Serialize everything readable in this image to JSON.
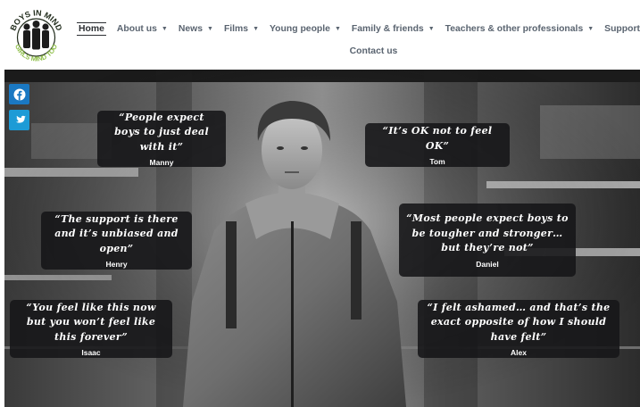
{
  "logo": {
    "top_text": "BOYS IN MIND",
    "bottom_text": "GIRLS MIND TOO"
  },
  "nav": {
    "items": [
      {
        "label": "Home",
        "active": true,
        "dropdown": false
      },
      {
        "label": "About us",
        "dropdown": true
      },
      {
        "label": "News",
        "dropdown": true
      },
      {
        "label": "Films",
        "dropdown": true
      },
      {
        "label": "Young people",
        "dropdown": true
      },
      {
        "label": "Family & friends",
        "dropdown": true
      },
      {
        "label": "Teachers & other professionals",
        "dropdown": true
      },
      {
        "label": "Support us",
        "dropdown": true
      }
    ],
    "second_row": [
      {
        "label": "Contact us",
        "dropdown": false
      }
    ],
    "caret": "▼"
  },
  "social": [
    {
      "name": "facebook-icon",
      "color": "#1a78c2"
    },
    {
      "name": "twitter-icon",
      "color": "#1d9bd6"
    }
  ],
  "quotes": [
    {
      "text": "“People expect boys to just deal with it”",
      "name": "Manny"
    },
    {
      "text": "“It’s OK not to feel OK”",
      "name": "Tom"
    },
    {
      "text": "“The support is there and it’s unbiased and open”",
      "name": "Henry"
    },
    {
      "text": "“Most people expect boys to be tougher and stronger… but they’re not”",
      "name": "Daniel"
    },
    {
      "text": "“You feel like this now but you won’t feel like this forever”",
      "name": "Isaac"
    },
    {
      "text": "“I felt ashamed… and that’s the exact opposite of how I should have felt”",
      "name": "Alex"
    }
  ],
  "colors": {
    "nav_text": "#5a6470",
    "quote_bg": "#161618",
    "logo_gold": "#c9a227",
    "logo_green": "#8fbf4a"
  }
}
